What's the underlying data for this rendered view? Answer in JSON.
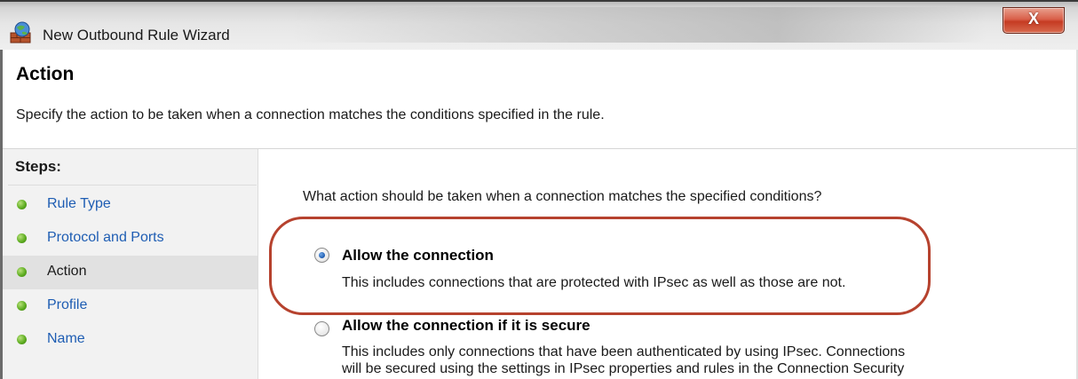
{
  "window": {
    "title": "New Outbound Rule Wizard",
    "close_glyph": "X"
  },
  "header": {
    "title": "Action",
    "description": "Specify the action to be taken when a connection matches the conditions specified in the rule."
  },
  "sidebar": {
    "title": "Steps:",
    "items": [
      {
        "label": "Rule Type",
        "icon": "green-dot-icon",
        "active": false
      },
      {
        "label": "Protocol and Ports",
        "icon": "green-dot-icon",
        "active": false
      },
      {
        "label": "Action",
        "icon": "green-dot-icon",
        "active": true
      },
      {
        "label": "Profile",
        "icon": "green-dot-icon",
        "active": false
      },
      {
        "label": "Name",
        "icon": "green-dot-icon",
        "active": false
      }
    ]
  },
  "main": {
    "question": "What action should be taken when a connection matches the specified conditions?",
    "options": [
      {
        "label": "Allow the connection",
        "description": "This includes connections that are protected with IPsec as well as those are not.",
        "selected": true
      },
      {
        "label": "Allow the connection if it is secure",
        "description_lines": [
          "This includes only connections that have been authenticated by using IPsec.  Connections",
          "will be secured using the settings in IPsec properties and rules in the Connection Security"
        ],
        "selected": false
      }
    ]
  },
  "colors": {
    "highlight": "#b6422e",
    "link": "#1e5db3",
    "step_dot": "#5fae22",
    "close_button": "#c53b22"
  }
}
